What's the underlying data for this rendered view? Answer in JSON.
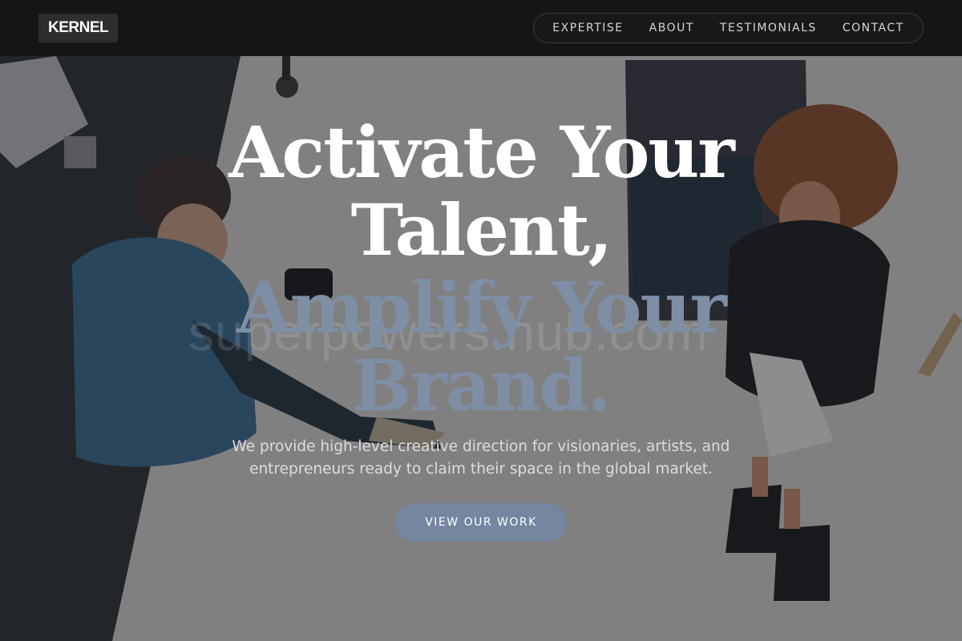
{
  "header": {
    "logo": "KERNEL",
    "nav": [
      "EXPERTISE",
      "ABOUT",
      "TESTIMONIALS",
      "CONTACT"
    ]
  },
  "hero": {
    "headline": {
      "line1": "Activate Your",
      "line2": "Talent,",
      "line3": "Amplify Your",
      "line4": "Brand."
    },
    "subtext_line1": "We provide high-level creative direction for visionaries, artists, and",
    "subtext_line2": "entrepreneurs ready to claim their space in the global market.",
    "cta_label": "VIEW OUR WORK",
    "watermark": "superpowers.hub.com"
  },
  "colors": {
    "header_bg": "#151515",
    "accent": "#7d8ea5",
    "button": "#7486a0",
    "text_light": "#dcdde0"
  }
}
